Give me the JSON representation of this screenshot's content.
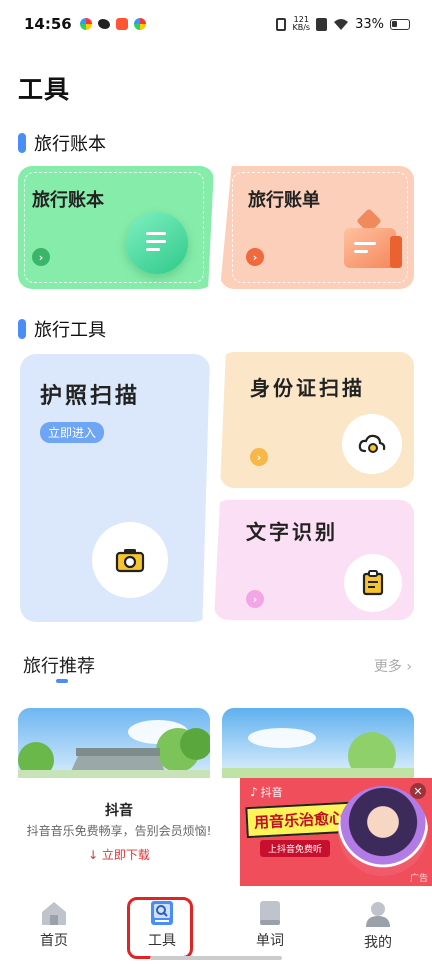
{
  "status_bar": {
    "time": "14:56",
    "net_speed_value": "121",
    "net_speed_unit": "KB/s",
    "battery": "33%"
  },
  "page": {
    "title": "工具"
  },
  "sections": {
    "travel_book": "旅行账本",
    "travel_tools": "旅行工具"
  },
  "cards": {
    "travel_book": {
      "title": "旅行账本",
      "color": "#86ecaa"
    },
    "travel_bill": {
      "title": "旅行账单",
      "color": "#fbcfb9"
    },
    "passport": {
      "title": "护照扫描",
      "enter_label": "立即进入",
      "color": "#dbe8fb"
    },
    "id_card": {
      "title": "身份证扫描",
      "color": "#fbe7c8"
    },
    "ocr": {
      "title": "文字识别",
      "color": "#fbe0f5"
    }
  },
  "recommend": {
    "title": "旅行推荐",
    "more": "更多 ›"
  },
  "ad": {
    "title": "抖音",
    "desc": "抖音音乐免费畅享，告别会员烦恼!",
    "download": "↓ 立即下载",
    "brand": "抖音",
    "headline": "用音乐治愈心灵",
    "button": "上抖音免费听",
    "tag": "广告"
  },
  "tabbar": {
    "items": [
      {
        "label": "首页",
        "icon": "home-icon",
        "active": false
      },
      {
        "label": "工具",
        "icon": "tools-book-icon",
        "active": true
      },
      {
        "label": "单词",
        "icon": "word-book-icon",
        "active": false
      },
      {
        "label": "我的",
        "icon": "profile-icon",
        "active": false
      }
    ]
  },
  "colors": {
    "accent": "#4a8ef5",
    "highlight_ring": "#e02424"
  }
}
